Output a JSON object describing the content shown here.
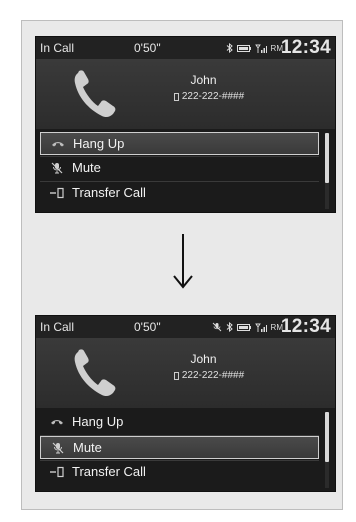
{
  "screens": [
    {
      "status": {
        "left": "In Call",
        "timer": "0'50\"",
        "signal_label": "RM",
        "clock": "12:34",
        "show_mute": false
      },
      "contact": {
        "name": "John",
        "number": "222-222-####"
      },
      "menu": [
        {
          "label": "Hang Up",
          "icon": "hang-up-icon",
          "selected": true
        },
        {
          "label": "Mute",
          "icon": "mute-icon",
          "selected": false
        },
        {
          "label": "Transfer Call",
          "icon": "transfer-call-icon",
          "selected": false
        }
      ]
    },
    {
      "status": {
        "left": "In Call",
        "timer": "0'50\"",
        "signal_label": "RM",
        "clock": "12:34",
        "show_mute": true
      },
      "contact": {
        "name": "John",
        "number": "222-222-####"
      },
      "menu": [
        {
          "label": "Hang Up",
          "icon": "hang-up-icon",
          "selected": false
        },
        {
          "label": "Mute",
          "icon": "mute-icon",
          "selected": true
        },
        {
          "label": "Transfer Call",
          "icon": "transfer-call-icon",
          "selected": false
        }
      ]
    }
  ],
  "transition_icon": "down-arrow-icon",
  "colors": {
    "screen_bg": "#181818",
    "panel_bg": "#333333",
    "selection_border": "#cfcfcf",
    "text": "#f2f2f2"
  }
}
